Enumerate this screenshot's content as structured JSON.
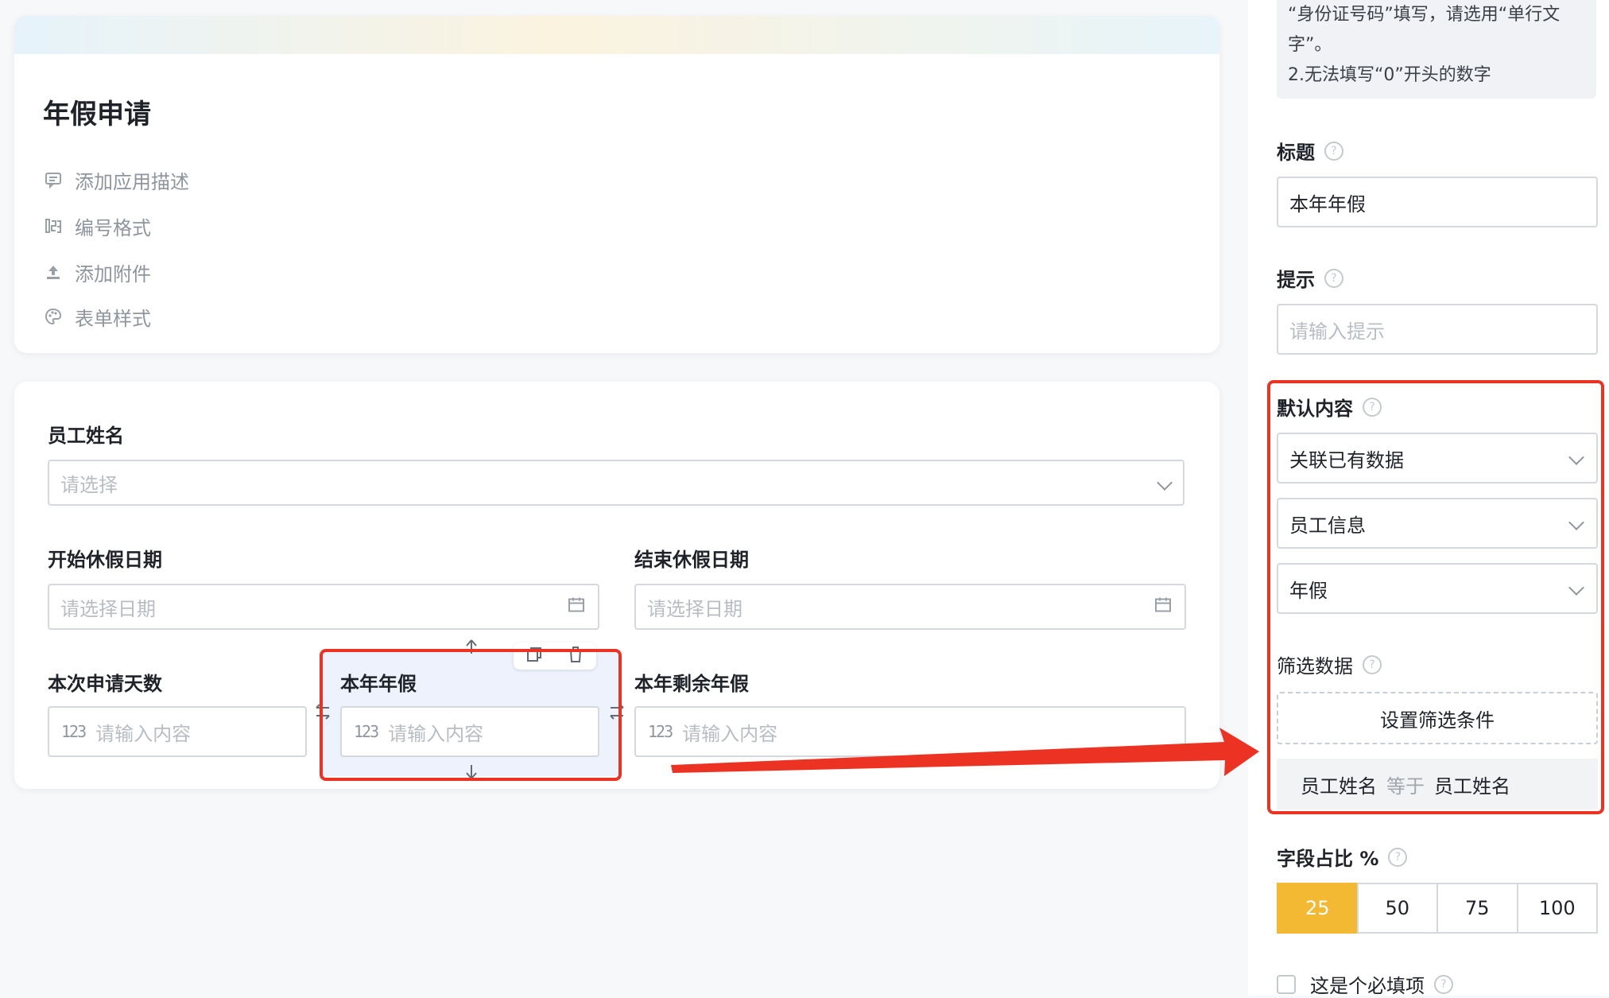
{
  "app": {
    "title": "年假申请",
    "meta": [
      {
        "icon": "comment-icon",
        "label": "添加应用描述"
      },
      {
        "icon": "number-format-icon",
        "label": "编号格式"
      },
      {
        "icon": "upload-icon",
        "label": "添加附件"
      },
      {
        "icon": "palette-icon",
        "label": "表单样式"
      }
    ]
  },
  "form": {
    "employee_name": {
      "label": "员工姓名",
      "placeholder": "请选择"
    },
    "start_date": {
      "label": "开始休假日期",
      "placeholder": "请选择日期"
    },
    "end_date": {
      "label": "结束休假日期",
      "placeholder": "请选择日期"
    },
    "days_requested": {
      "label": "本次申请天数",
      "placeholder": "请输入内容"
    },
    "annual_leave": {
      "label": "本年年假",
      "placeholder": "请输入内容"
    },
    "remaining_leave": {
      "label": "本年剩余年假",
      "placeholder": "请输入内容"
    },
    "number_icon_text": "123"
  },
  "panel": {
    "help_lines": [
      "“身份证号码”填写，请选用“单行文",
      "字”。",
      "2.无法填写“0”开头的数字"
    ],
    "title_label": "标题",
    "title_value": "本年年假",
    "hint_label": "提示",
    "hint_placeholder": "请输入提示",
    "default_label": "默认内容",
    "default_mode": "关联已有数据",
    "default_source": "员工信息",
    "default_field": "年假",
    "filter_label": "筛选数据",
    "filter_button": "设置筛选条件",
    "condition": {
      "left": "员工姓名",
      "op": "等于",
      "right": "员工姓名"
    },
    "ratio_label": "字段占比 %",
    "ratio_options": [
      "25",
      "50",
      "75",
      "100"
    ],
    "ratio_selected": "25",
    "required_label": "这是个必填项"
  },
  "colors": {
    "highlight": "#ec3323",
    "accent": "#f3b933",
    "selected_bg": "#edf2fd"
  }
}
